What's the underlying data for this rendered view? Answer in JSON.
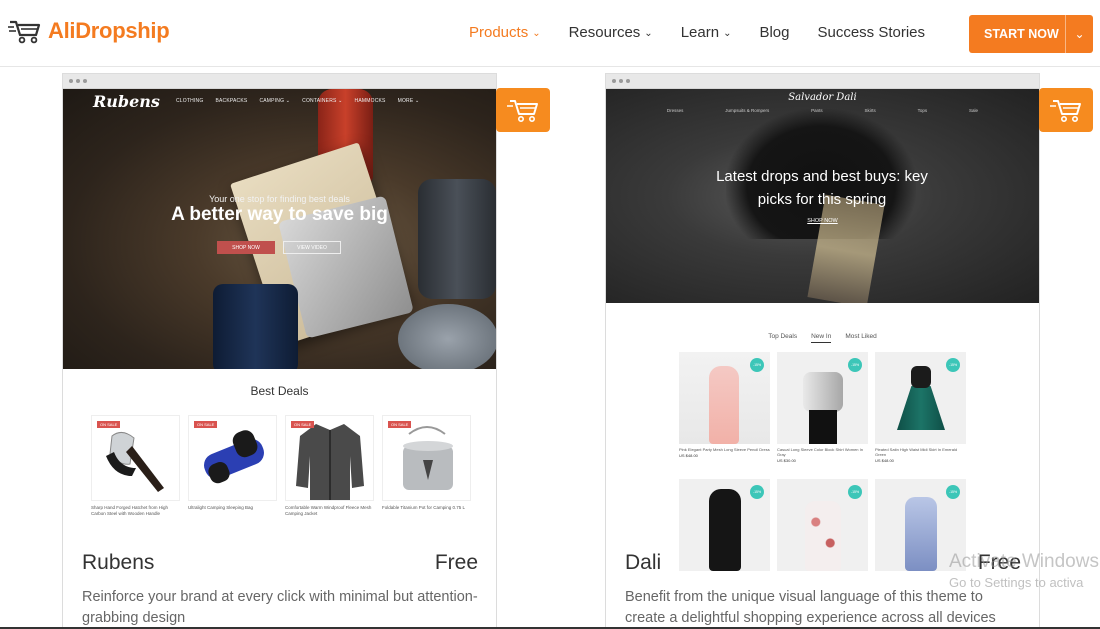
{
  "brand": {
    "name": "AliDropship",
    "accent": "#f47b20"
  },
  "nav": {
    "items": [
      {
        "label": "Products",
        "has_dropdown": true,
        "active": true
      },
      {
        "label": "Resources",
        "has_dropdown": true,
        "active": false
      },
      {
        "label": "Learn",
        "has_dropdown": true,
        "active": false
      },
      {
        "label": "Blog",
        "has_dropdown": false,
        "active": false
      },
      {
        "label": "Success Stories",
        "has_dropdown": false,
        "active": false
      }
    ],
    "cta": "START NOW"
  },
  "themes": [
    {
      "name": "Rubens",
      "price": "Free",
      "description": "Reinforce your brand at every click with minimal but attention-grabbing design",
      "preview": {
        "logo": "Rubens",
        "menu": [
          "CLOTHING",
          "BACKPACKS",
          "CAMPING ⌄",
          "CONTAINERS ⌄",
          "HAMMOCKS",
          "MORE ⌄"
        ],
        "tagline": "Your one stop for finding best deals",
        "headline": "A better way to save big",
        "primary_button": "SHOP NOW",
        "secondary_button": "VIEW VIDEO",
        "section_title": "Best Deals",
        "sale_badge": "ON SALE",
        "products": [
          {
            "title": "Sharp Hand Forged Hatchet from High Carbon Steel with Wooden Handle"
          },
          {
            "title": "Ultralight Camping Sleeping Bag"
          },
          {
            "title": "Comfortable Warm Windproof Fleece Mesh Camping Jacket"
          },
          {
            "title": "Foldable Titanium Pot for Camping 0.75 L"
          }
        ]
      }
    },
    {
      "name": "Dali",
      "price": "Free",
      "description": "Benefit from the unique visual language of this theme to create a delightful shopping experience across all devices",
      "preview": {
        "logo": "Salvador Dali",
        "menu": [
          "Dresses",
          "Jumpsuits & Rompers",
          "Pants",
          "Skirts",
          "Tops",
          "Sale"
        ],
        "headline": "Latest drops and best buys: key picks for this spring",
        "shop_link": "SHOP NOW",
        "tabs": [
          "Top Deals",
          "New In",
          "Most Liked"
        ],
        "selected_tab": "New In",
        "badge": "-15%",
        "products": [
          {
            "title": "Pink Elegant Party Mesh Long Sleeve Pencil Dress",
            "price": "US $48.00"
          },
          {
            "title": "Casual Long Sleeve Color Block Shirt Women In Gray",
            "price": "US $30.00"
          },
          {
            "title": "Pleated Satin High Waist Midi Skirt In Emerald Green",
            "price": "US $48.00"
          },
          {
            "title": "",
            "price": ""
          },
          {
            "title": "",
            "price": ""
          },
          {
            "title": "",
            "price": ""
          }
        ]
      }
    }
  ],
  "watermark": {
    "line1": "Activate Windows",
    "line2": "Go to Settings to activa"
  }
}
